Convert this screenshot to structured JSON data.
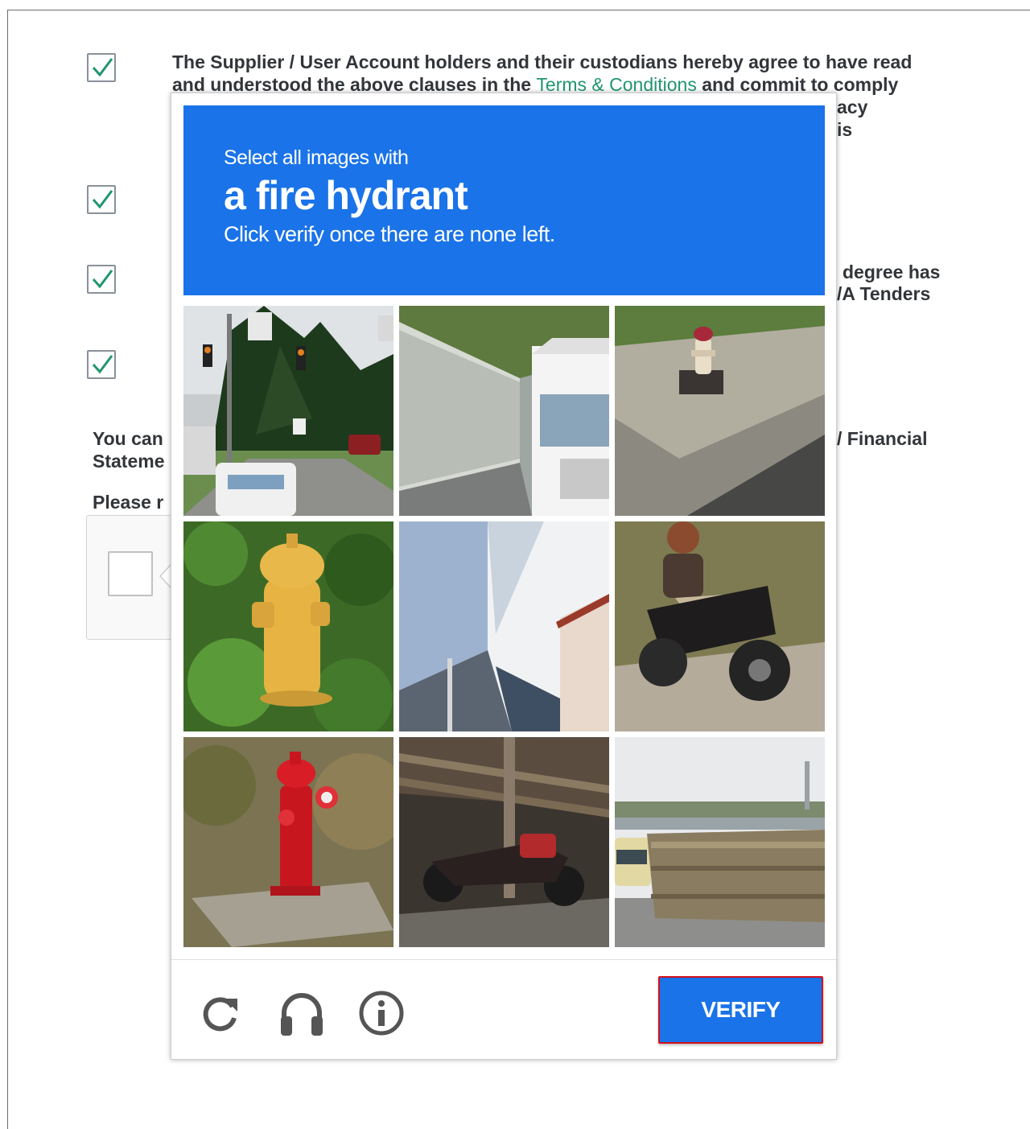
{
  "agreement": {
    "clause1_line1": "The Supplier / User Account holders and their custodians hereby agree to have read",
    "clause1_line2_pre": "and understood the above clauses in the",
    "clause1_link": "Terms & Conditions",
    "clause1_line2_post": "and commit to comply",
    "clause1_line3_fragment": "acy",
    "clause1_line4_fragment": "is",
    "clause3_line1_fragment": "degree has",
    "clause3_line2_fragment": "/A Tenders",
    "note_line1_left": "You can",
    "note_line1_right": "/ Financial",
    "note_line2_left": "Stateme",
    "please_line": "Please r"
  },
  "captcha": {
    "instruction_small": "Select all images with",
    "instruction_target": "a fire hydrant",
    "instruction_hint": "Click verify once there are none left.",
    "tiles": [
      {
        "content": "street with traffic lights and van"
      },
      {
        "content": "truck beside fence"
      },
      {
        "content": "fire hydrant on sidewalk"
      },
      {
        "content": "yellow fire hydrant in grass"
      },
      {
        "content": "building corner"
      },
      {
        "content": "person riding motorcycle"
      },
      {
        "content": "red fire hydrant"
      },
      {
        "content": "motorcycle under shelter"
      },
      {
        "content": "bus and highway barrier"
      }
    ],
    "verify_label": "VERIFY"
  },
  "colors": {
    "accent_blue": "#1a73e8",
    "check_green": "#21966e",
    "verify_outline": "#d4101c"
  },
  "icons": [
    "reload-icon",
    "headphones-icon",
    "info-icon",
    "checkmark-icon"
  ]
}
